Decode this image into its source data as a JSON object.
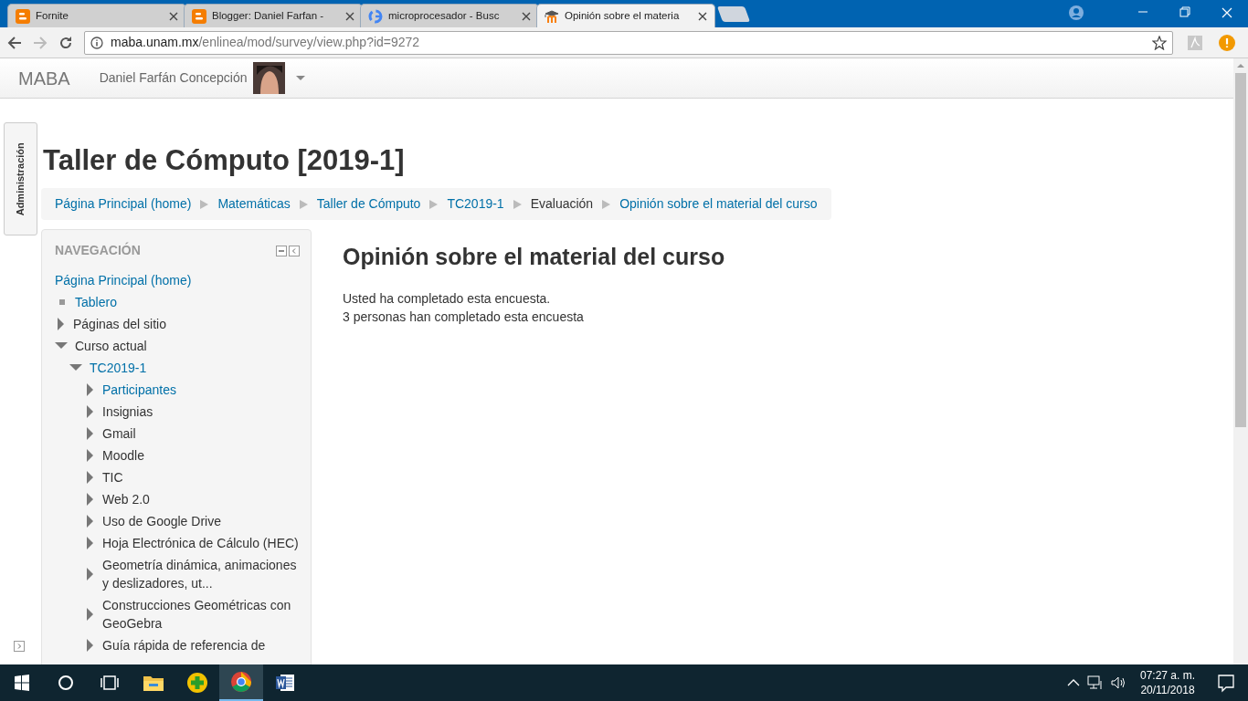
{
  "tabs": [
    {
      "kind": "blogger",
      "title": "Fornite",
      "selected": false
    },
    {
      "kind": "blogger",
      "title": "Blogger: Daniel Farfan -",
      "selected": false
    },
    {
      "kind": "google",
      "title": "microprocesador - Busc",
      "selected": false
    },
    {
      "kind": "moodle",
      "title": "Opinión sobre el materia",
      "selected": true
    }
  ],
  "address": {
    "host": "maba.unam.mx",
    "path": "/enlinea/mod/survey/view.php?id=9272"
  },
  "navbar": {
    "brand": "MABA",
    "user": "Daniel Farfán Concepción"
  },
  "admin_tab": "Administración",
  "course_title": "Taller de Cómputo [2019-1]",
  "breadcrumb": [
    {
      "label": "Página Principal (home)",
      "link": true
    },
    {
      "label": "Matemáticas",
      "link": true
    },
    {
      "label": "Taller de Cómputo",
      "link": true
    },
    {
      "label": "TC2019-1",
      "link": true
    },
    {
      "label": "Evaluación",
      "link": false
    },
    {
      "label": "Opinión sobre el material del curso",
      "link": true
    }
  ],
  "navigation": {
    "title": "NAVEGACIÓN",
    "items": [
      {
        "kind": "plain",
        "label": "Página Principal (home)",
        "link": true
      },
      {
        "kind": "leaf",
        "label": "Tablero",
        "link": true
      },
      {
        "kind": "branch",
        "label": "Páginas del sitio",
        "link": false,
        "expanded": false
      },
      {
        "kind": "branch",
        "label": "Curso actual",
        "link": false,
        "expanded": true,
        "children": [
          {
            "kind": "branch",
            "label": "TC2019-1",
            "link": true,
            "expanded": true,
            "children": [
              {
                "kind": "branch",
                "label": "Participantes",
                "link": true,
                "expanded": false
              },
              {
                "kind": "branch",
                "label": "Insignias",
                "link": false,
                "expanded": false
              },
              {
                "kind": "branch",
                "label": "Gmail",
                "link": false,
                "expanded": false
              },
              {
                "kind": "branch",
                "label": "Moodle",
                "link": false,
                "expanded": false
              },
              {
                "kind": "branch",
                "label": "TIC",
                "link": false,
                "expanded": false
              },
              {
                "kind": "branch",
                "label": "Web 2.0",
                "link": false,
                "expanded": false
              },
              {
                "kind": "branch",
                "label": "Uso de Google Drive",
                "link": false,
                "expanded": false
              },
              {
                "kind": "branch",
                "label": "Hoja Electrónica de Cálculo (HEC)",
                "link": false,
                "expanded": false
              },
              {
                "kind": "branch",
                "label": "Geometría dinámica, animaciones y deslizadores, ut...",
                "link": false,
                "expanded": false
              },
              {
                "kind": "branch",
                "label": "Construcciones Geométricas con GeoGebra",
                "link": false,
                "expanded": false
              },
              {
                "kind": "branch",
                "label": "Guía rápida de referencia de",
                "link": false,
                "expanded": false
              }
            ]
          }
        ]
      }
    ]
  },
  "survey": {
    "title": "Opinión sobre el material del curso",
    "lines": [
      "Usted ha completado esta encuesta.",
      "3 personas han completado esta encuesta"
    ]
  },
  "taskbar": {
    "apps": [
      {
        "kind": "explorer",
        "selected": false
      },
      {
        "kind": "plus",
        "selected": false
      },
      {
        "kind": "chrome",
        "selected": true
      },
      {
        "kind": "word",
        "selected": false
      }
    ],
    "time": "07:27 a. m.",
    "date": "20/11/2018"
  }
}
